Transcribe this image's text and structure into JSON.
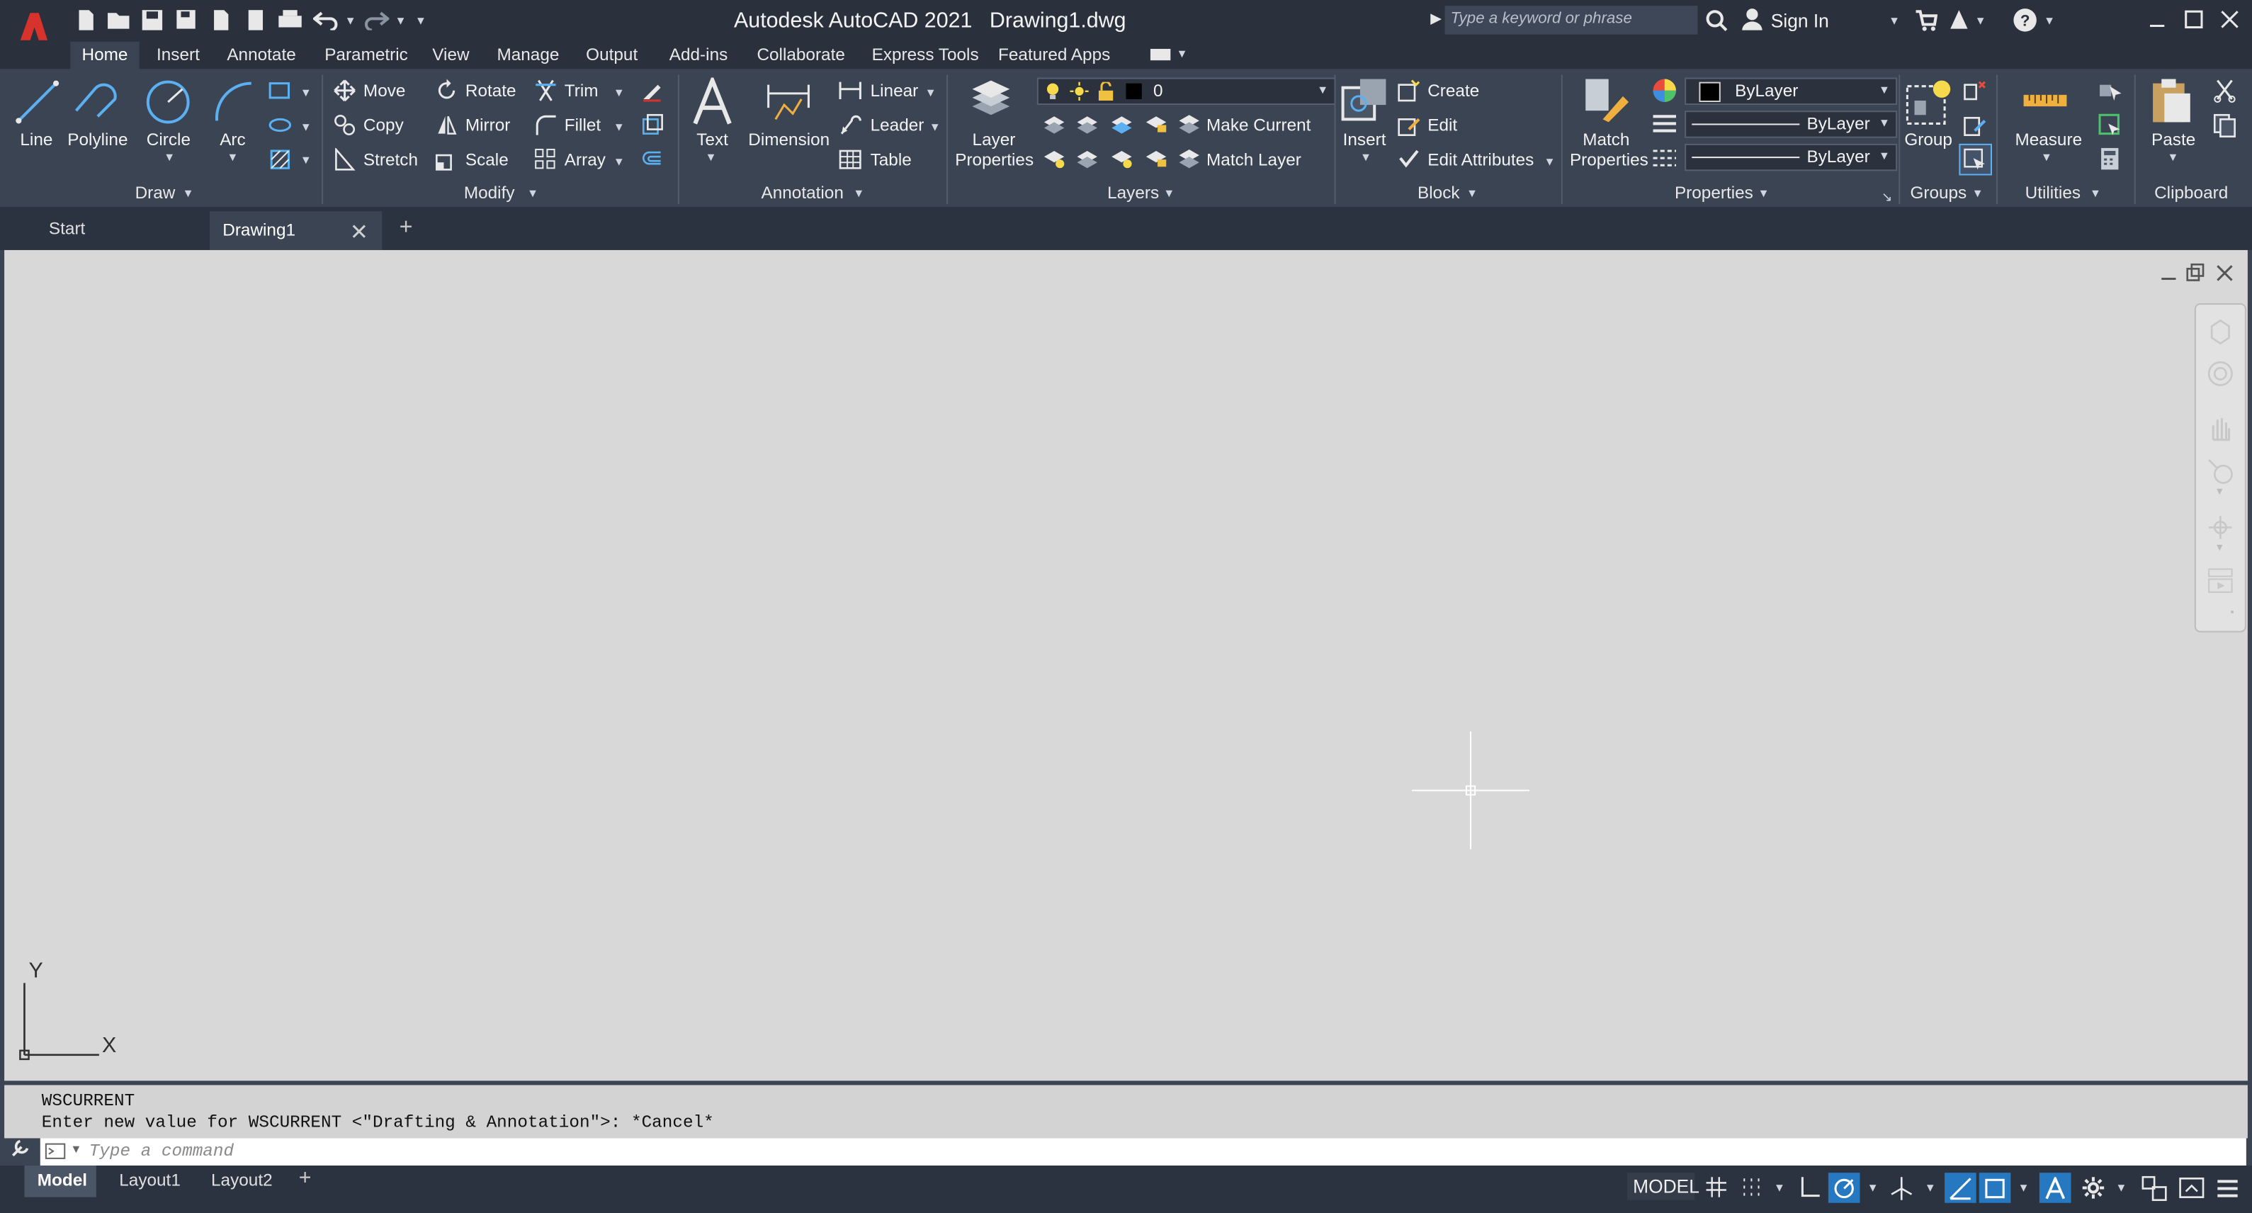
{
  "app": {
    "title": "Autodesk AutoCAD 2021",
    "filename": "Drawing1.dwg",
    "search_placeholder": "Type a keyword or phrase",
    "sign_in": "Sign In"
  },
  "ribbon_tabs": [
    "Home",
    "Insert",
    "Annotate",
    "Parametric",
    "View",
    "Manage",
    "Output",
    "Add-ins",
    "Collaborate",
    "Express Tools",
    "Featured Apps"
  ],
  "ribbon": {
    "draw": {
      "line": "Line",
      "polyline": "Polyline",
      "circle": "Circle",
      "arc": "Arc",
      "title": "Draw"
    },
    "modify": {
      "move": "Move",
      "rotate": "Rotate",
      "trim": "Trim",
      "copy": "Copy",
      "mirror": "Mirror",
      "fillet": "Fillet",
      "stretch": "Stretch",
      "scale": "Scale",
      "array": "Array",
      "title": "Modify"
    },
    "annotation": {
      "text": "Text",
      "dimension": "Dimension",
      "linear": "Linear",
      "leader": "Leader",
      "table": "Table",
      "title": "Annotation"
    },
    "layers": {
      "layer_properties_1": "Layer",
      "layer_properties_2": "Properties",
      "current_layer": "0",
      "make_current": "Make Current",
      "match_layer": "Match Layer",
      "title": "Layers"
    },
    "block": {
      "insert": "Insert",
      "create": "Create",
      "edit": "Edit",
      "edit_attributes": "Edit Attributes",
      "title": "Block"
    },
    "properties": {
      "match_1": "Match",
      "match_2": "Properties",
      "color": "ByLayer",
      "linetype": "ByLayer",
      "lineweight": "ByLayer",
      "title": "Properties"
    },
    "groups": {
      "group": "Group",
      "title": "Groups"
    },
    "utilities": {
      "measure": "Measure",
      "title": "Utilities"
    },
    "clipboard": {
      "paste": "Paste",
      "title": "Clipboard"
    }
  },
  "doc_tabs": {
    "start": "Start",
    "drawing": "Drawing1"
  },
  "ucs": {
    "x": "X",
    "y": "Y"
  },
  "command": {
    "history_1": "WSCURRENT",
    "history_2": "Enter new value for WSCURRENT <\"Drafting & Annotation\">: *Cancel*",
    "placeholder": "Type a command"
  },
  "layout_tabs": [
    "Model",
    "Layout1",
    "Layout2"
  ],
  "status": {
    "model": "MODEL"
  },
  "colors": {
    "canvas": "#d8d8d8",
    "ribbon": "#3b4453",
    "titlebar": "#2a313d",
    "accent_red": "#d8322d",
    "accent_blue": "#1e8fd8"
  }
}
